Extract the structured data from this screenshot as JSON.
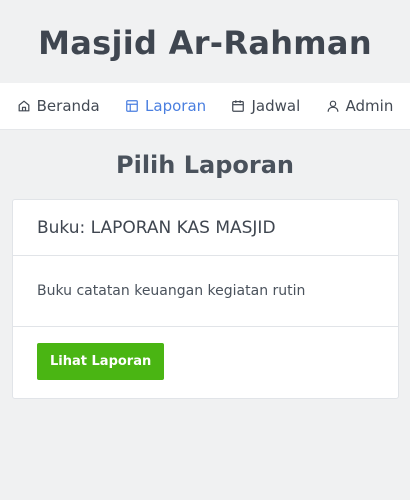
{
  "site": {
    "title": "Masjid Ar-Rahman"
  },
  "nav": {
    "items": [
      {
        "label": "Beranda",
        "icon": "home-icon",
        "active": false
      },
      {
        "label": "Laporan",
        "icon": "layout-icon",
        "active": true
      },
      {
        "label": "Jadwal",
        "icon": "calendar-icon",
        "active": false
      },
      {
        "label": "Admin",
        "icon": "user-icon",
        "active": false
      }
    ],
    "active_color": "#4a7fe0"
  },
  "main": {
    "heading": "Pilih Laporan",
    "card": {
      "title": "Buku: LAPORAN KAS MASJID",
      "description": "Buku catatan keuangan kegiatan rutin",
      "button_label": "Lihat Laporan",
      "button_color": "#4ab513"
    }
  }
}
